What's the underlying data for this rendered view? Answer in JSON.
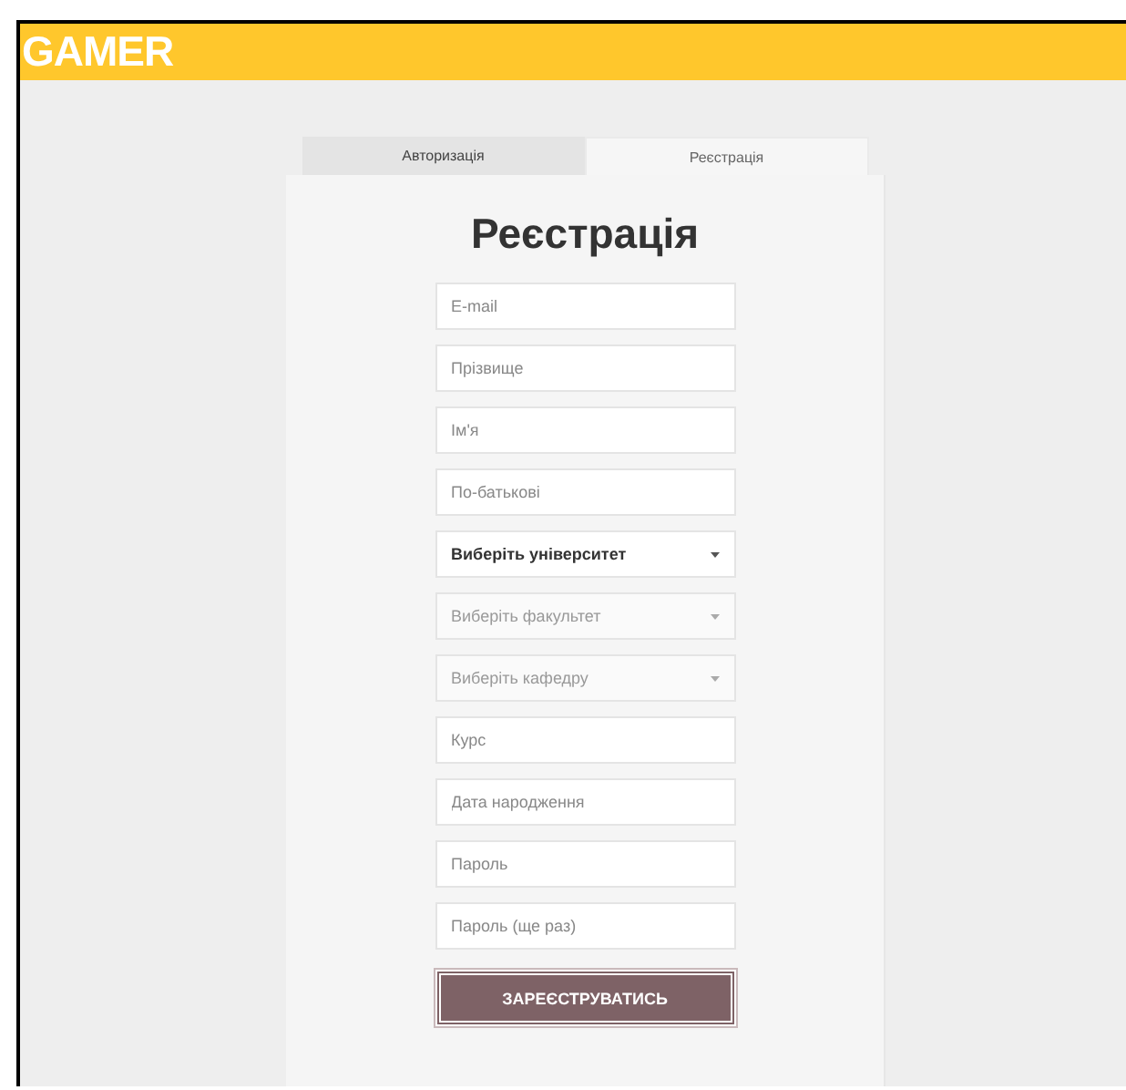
{
  "header": {
    "logo": "GAMER"
  },
  "tabs": [
    {
      "label": "Авторизація",
      "selected": false
    },
    {
      "label": "Реєстрація",
      "selected": true
    }
  ],
  "form": {
    "title": "Реєстрація",
    "fields": [
      {
        "kind": "input",
        "placeholder": "E-mail"
      },
      {
        "kind": "input",
        "placeholder": "Прізвище"
      },
      {
        "kind": "input",
        "placeholder": "Ім'я"
      },
      {
        "kind": "input",
        "placeholder": "По-батькові"
      },
      {
        "kind": "select",
        "value": "Виберіть університет",
        "disabled": false
      },
      {
        "kind": "select",
        "value": "Виберіть факультет",
        "disabled": true
      },
      {
        "kind": "select",
        "value": "Виберіть кафедру",
        "disabled": true
      },
      {
        "kind": "input",
        "placeholder": "Курс"
      },
      {
        "kind": "input",
        "placeholder": "Дата народження"
      },
      {
        "kind": "input",
        "placeholder": "Пароль"
      },
      {
        "kind": "input",
        "placeholder": "Пароль (ще раз)"
      }
    ],
    "submit": "ЗАРЕЄСТРУВАТИСЬ"
  }
}
